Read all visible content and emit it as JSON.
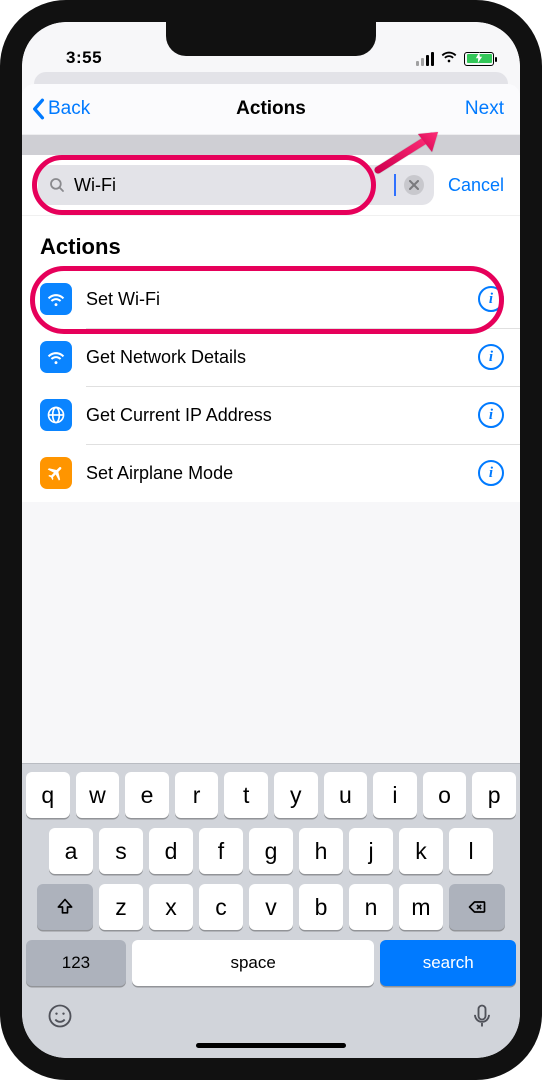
{
  "status": {
    "time": "3:55"
  },
  "nav": {
    "back": "Back",
    "title": "Actions",
    "next": "Next"
  },
  "search": {
    "value": "Wi-Fi",
    "cancel": "Cancel"
  },
  "section_header": "Actions",
  "actions": [
    {
      "label": "Set Wi-Fi",
      "icon": "wifi",
      "bg": "blue"
    },
    {
      "label": "Get Network Details",
      "icon": "wifi",
      "bg": "blue"
    },
    {
      "label": "Get Current IP Address",
      "icon": "globe",
      "bg": "blue"
    },
    {
      "label": "Set Airplane Mode",
      "icon": "airplane",
      "bg": "orange"
    }
  ],
  "keyboard": {
    "row1": [
      "q",
      "w",
      "e",
      "r",
      "t",
      "y",
      "u",
      "i",
      "o",
      "p"
    ],
    "row2": [
      "a",
      "s",
      "d",
      "f",
      "g",
      "h",
      "j",
      "k",
      "l"
    ],
    "row3": [
      "z",
      "x",
      "c",
      "v",
      "b",
      "n",
      "m"
    ],
    "numbers": "123",
    "space": "space",
    "search": "search"
  }
}
